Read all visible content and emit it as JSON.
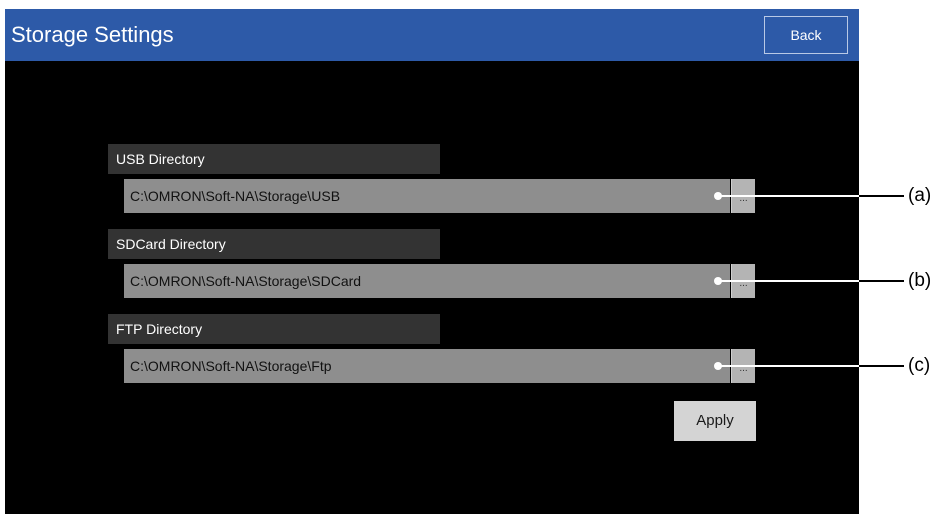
{
  "header": {
    "title": "Storage Settings",
    "back_label": "Back"
  },
  "directories": [
    {
      "label": "USB Directory",
      "path": "C:\\OMRON\\Soft-NA\\Storage\\USB",
      "browse_label": "..."
    },
    {
      "label": "SDCard Directory",
      "path": "C:\\OMRON\\Soft-NA\\Storage\\SDCard",
      "browse_label": "..."
    },
    {
      "label": "FTP Directory",
      "path": "C:\\OMRON\\Soft-NA\\Storage\\Ftp",
      "browse_label": "..."
    }
  ],
  "apply_label": "Apply",
  "callouts": [
    "(a)",
    "(b)",
    "(c)"
  ],
  "colors": {
    "title_bar": "#2d5aa8",
    "screen_bg": "#000000",
    "label_bg": "#333333",
    "field_bg": "#8e8e8e",
    "button_bg": "#d4d4d4"
  }
}
